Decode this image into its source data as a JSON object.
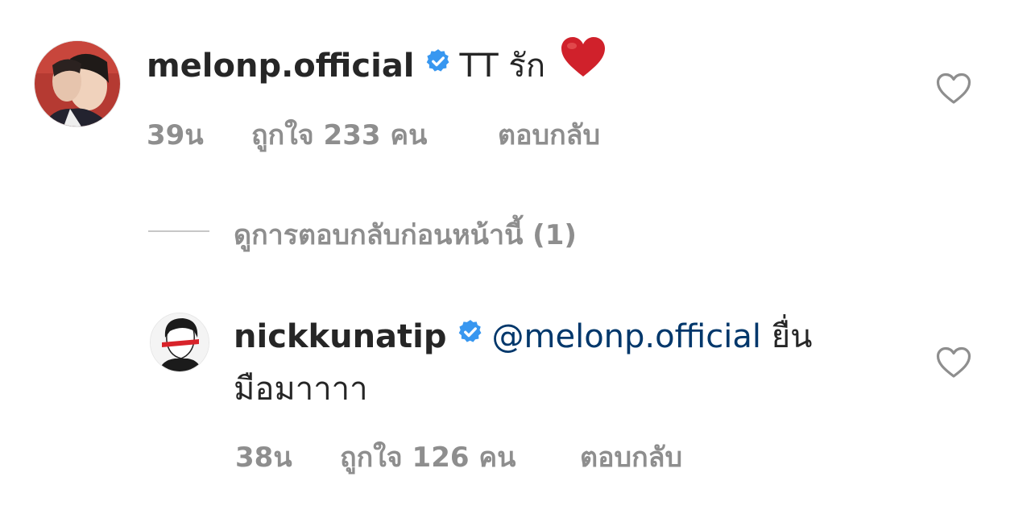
{
  "comments": [
    {
      "username": "melonp.official",
      "verified": true,
      "text": "TT รัก",
      "emoji": "heart",
      "time": "39น",
      "likes": "ถูกใจ 233 คน",
      "reply_label": "ตอบกลับ"
    },
    {
      "username": "nickkunatip",
      "verified": true,
      "mention": "@melonp.official",
      "text_inline": "ยื่น",
      "text_continued": "มือมาาาา",
      "time": "38น",
      "likes": "ถูกใจ 126 คน",
      "reply_label": "ตอบกลับ"
    }
  ],
  "view_replies": "ดูการตอบกลับก่อนหน้านี้ (1)",
  "colors": {
    "text": "#262626",
    "secondary": "#8e8e8e",
    "mention": "#00376b",
    "verified": "#3897f0",
    "emoji_heart": "#d0212b"
  },
  "icons": {
    "like": "heart-outline-icon",
    "verified": "verified-badge-icon"
  }
}
